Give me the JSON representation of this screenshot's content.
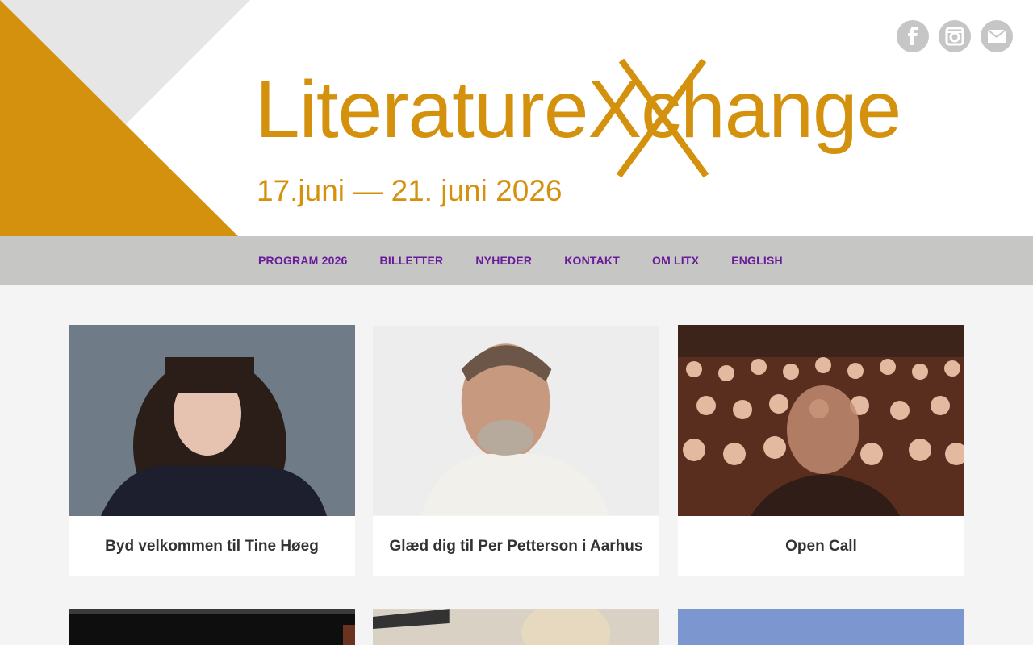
{
  "banner": {
    "logo_text": "LiteratureXchange",
    "dates": "17.juni — 21. juni 2026",
    "brand_color": "#d4910e"
  },
  "social": [
    {
      "icon": "facebook-icon",
      "label": "Facebook"
    },
    {
      "icon": "instagram-icon",
      "label": "Instagram"
    },
    {
      "icon": "mail-icon",
      "label": "Mail"
    }
  ],
  "nav": {
    "items": [
      "PROGRAM 2026",
      "BILLETTER",
      "NYHEDER",
      "KONTAKT",
      "OM LITX",
      "ENGLISH"
    ],
    "color": "#6a1a9a"
  },
  "cards": [
    {
      "title": "Byd velkommen til Tine Høeg"
    },
    {
      "title": "Glæd dig til Per Petterson i Aarhus"
    },
    {
      "title": "Open Call"
    }
  ]
}
